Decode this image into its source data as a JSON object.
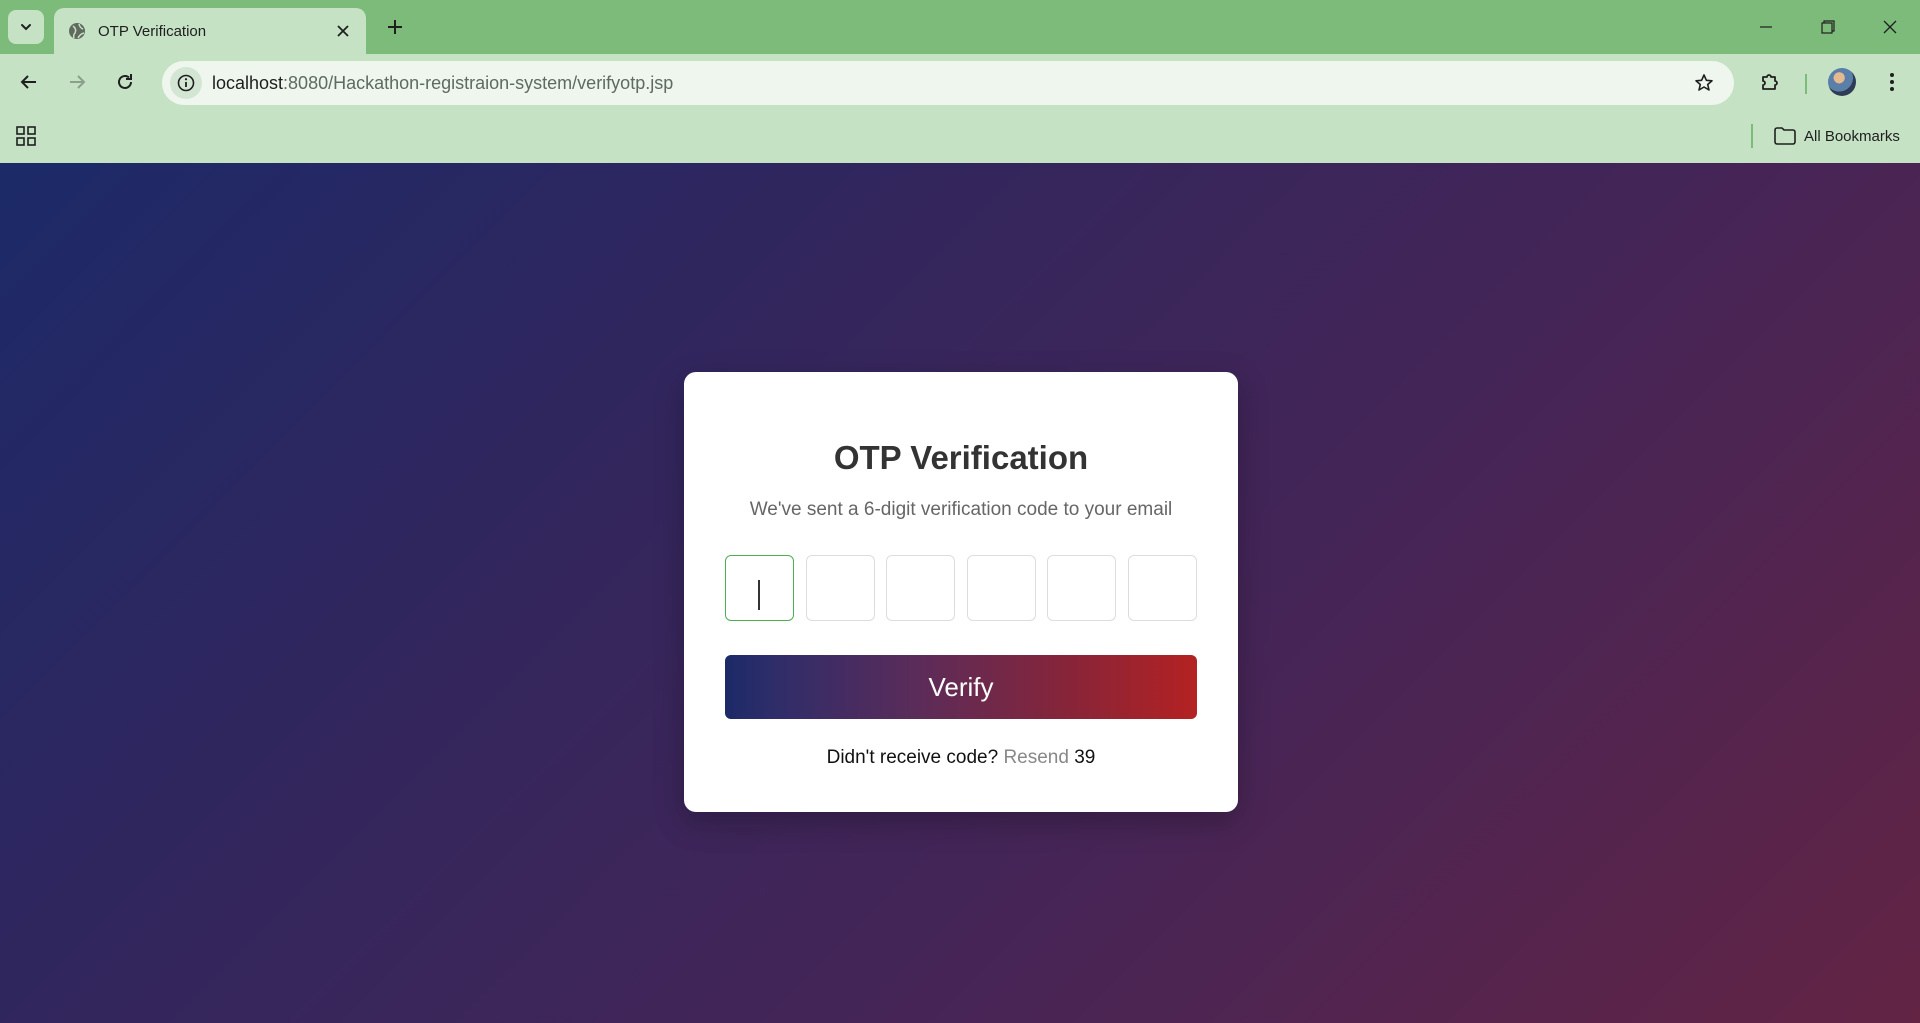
{
  "browser": {
    "tab_title": "OTP Verification",
    "url_host": "localhost",
    "url_rest": ":8080/Hackathon-registraion-system/verifyotp.jsp",
    "bookmarks_label": "All Bookmarks"
  },
  "page": {
    "title": "OTP Verification",
    "subtitle": "We've sent a 6-digit verification code to your email",
    "otp_digits": [
      "",
      "",
      "",
      "",
      "",
      ""
    ],
    "verify_label": "Verify",
    "resend_prompt": "Didn't receive code?",
    "resend_label": "Resend",
    "resend_timer": "39"
  },
  "colors": {
    "chrome_tabbar": "#7dbb7a",
    "chrome_toolbar": "#c5e2c5",
    "background_start": "#1c2a68",
    "background_end": "#632444",
    "button_gradient_start": "#1c2a68",
    "button_gradient_end": "#b42222",
    "focus_border": "#4caf50"
  },
  "icons": {
    "tab_search": "chevron-down-icon",
    "favicon": "globe-icon",
    "tab_close": "close-icon",
    "new_tab": "plus-icon",
    "back": "arrow-left-icon",
    "forward": "arrow-right-icon",
    "reload": "reload-icon",
    "site_info": "info-icon",
    "bookmark_star": "star-icon",
    "extensions": "puzzle-icon",
    "menu": "kebab-menu-icon",
    "apps": "apps-grid-icon",
    "folder": "folder-icon"
  }
}
